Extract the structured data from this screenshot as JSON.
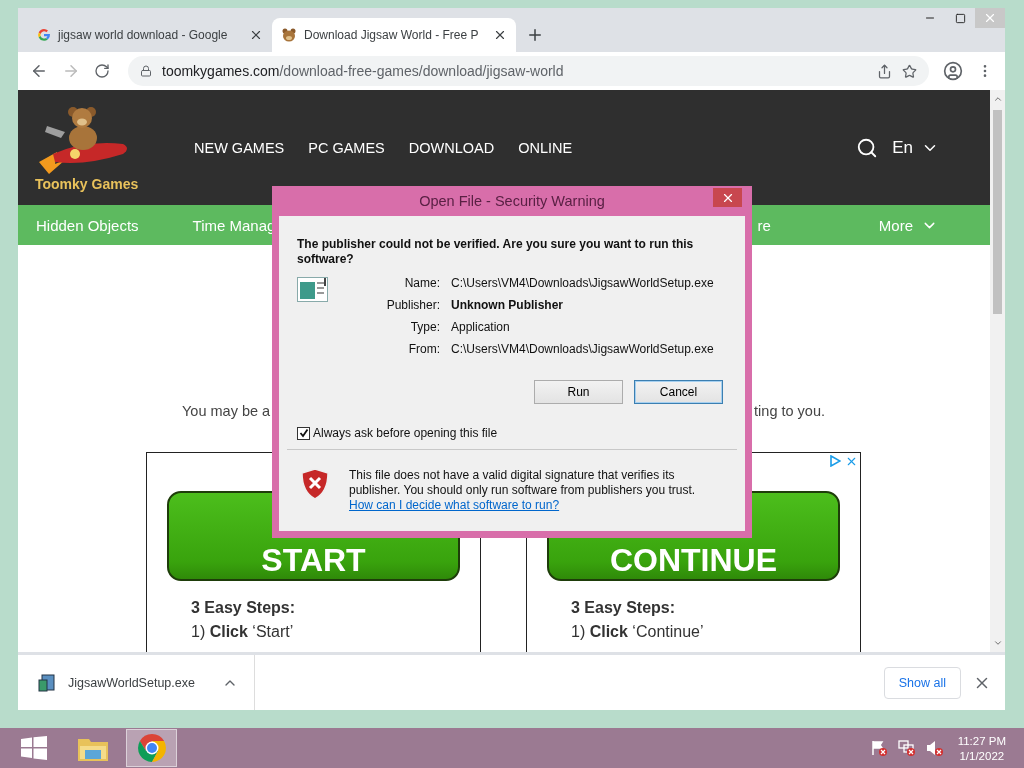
{
  "browser": {
    "tabs": [
      {
        "title": "jigsaw world download - Google",
        "selected": false
      },
      {
        "title": "Download Jigsaw World - Free P",
        "selected": true
      }
    ],
    "address": {
      "domain": "toomkygames.com",
      "path": "/download-free-games/download/jigsaw-world"
    }
  },
  "site": {
    "logo_text": "Toomky Games",
    "nav": [
      "NEW GAMES",
      "PC GAMES",
      "DOWNLOAD",
      "ONLINE"
    ],
    "language": "En",
    "categories": [
      "Hidden Objects",
      "Time Manag"
    ],
    "category_tail": "re",
    "more": "More",
    "notice_start": "You may be a",
    "notice_end": "ting to you.",
    "ad": [
      {
        "button": "START",
        "steps_title": "3 Easy Steps:",
        "step": "1) **Click** ‘Start’"
      },
      {
        "button": "CONTINUE",
        "steps_title": "3 Easy Steps:",
        "step": "1) **Click** ‘Continue’"
      }
    ]
  },
  "dialog": {
    "title": "Open File - Security Warning",
    "heading": "The publisher could not be verified.  Are you sure you want to run this software?",
    "fields": [
      {
        "label": "Name:",
        "value": "C:\\Users\\VM4\\Downloads\\JigsawWorldSetup.exe",
        "bold": false
      },
      {
        "label": "Publisher:",
        "value": "Unknown Publisher",
        "bold": true
      },
      {
        "label": "Type:",
        "value": "Application",
        "bold": false
      },
      {
        "label": "From:",
        "value": "C:\\Users\\VM4\\Downloads\\JigsawWorldSetup.exe",
        "bold": false
      }
    ],
    "buttons": [
      {
        "label": "Run",
        "focused": false
      },
      {
        "label": "Cancel",
        "focused": true
      }
    ],
    "checkbox": {
      "label": "Always ask before opening this file",
      "checked": true
    },
    "warning": "This file does not have a valid digital signature that verifies its publisher.  You should only run software from publishers you trust.",
    "link": "How can I decide what software to run?"
  },
  "downloads": {
    "file": "JigsawWorldSetup.exe",
    "show_all": "Show all"
  },
  "taskbar": {
    "apps": [
      {
        "kind": "explorer",
        "selected": false
      },
      {
        "kind": "chrome",
        "selected": true
      }
    ],
    "time": "11:27 PM",
    "date": "1/1/2022"
  }
}
